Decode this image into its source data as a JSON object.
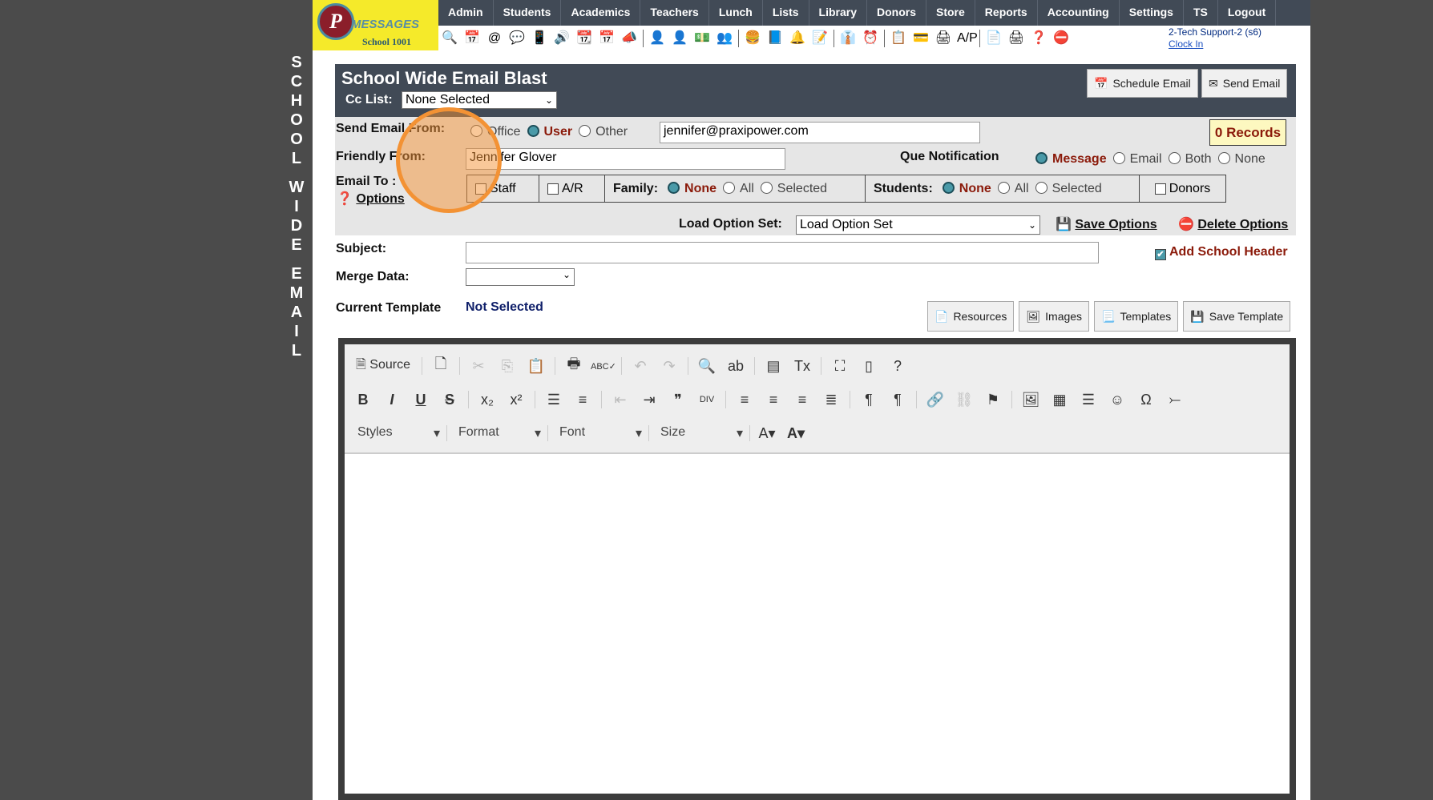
{
  "sidebar_vertical": [
    "S",
    "C",
    "H",
    "O",
    "O",
    "L",
    "",
    "W",
    "I",
    "D",
    "E",
    "",
    "E",
    "M",
    "A",
    "I",
    "L"
  ],
  "logo": {
    "letter": "P",
    "brand": "MESSAGES",
    "school": "School 1001"
  },
  "nav": [
    "Admin",
    "Students",
    "Academics",
    "Teachers",
    "Lunch",
    "Lists",
    "Library",
    "Donors",
    "Store",
    "Reports",
    "Accounting",
    "Settings",
    "TS",
    "Logout"
  ],
  "icon_bar": [
    "🔍",
    "📅",
    "@",
    "💬",
    "📱",
    "🔊",
    "📆",
    "📅",
    "📣",
    "|",
    "👤",
    "👤",
    "💵",
    "👥",
    "|",
    "🍔",
    "📘",
    "🔔",
    "📝",
    "|",
    "👔",
    "⏰",
    "|",
    "📋",
    "💳",
    "🖨",
    "A/P",
    "|",
    "📄",
    "🖨",
    "❓",
    "⛔"
  ],
  "user": {
    "name": "2-Tech Support-2 (s6)",
    "clock_in": "Clock In"
  },
  "header": {
    "title": "School Wide Email Blast",
    "cc_label": "Cc List:",
    "cc_value": "None Selected",
    "schedule": "Schedule Email",
    "send": "Send Email"
  },
  "form": {
    "send_from_label": "Send Email From:",
    "from_options": [
      "Office",
      "User",
      "Other"
    ],
    "from_email": "jennifer@praxipower.com",
    "records": "0 Records",
    "friendly_label": "Friendly From:",
    "friendly_value": "Jennifer Glover",
    "que_label": "Que Notification",
    "que_options": [
      "Message",
      "Email",
      "Both",
      "None"
    ],
    "email_to_label": "Email To :",
    "options_link": "Options",
    "staff": "Staff",
    "ar": "A/R",
    "family_label": "Family:",
    "family_options": [
      "None",
      "All",
      "Selected"
    ],
    "students_label": "Students:",
    "students_options": [
      "None",
      "All",
      "Selected"
    ],
    "donors": "Donors",
    "load_label": "Load Option Set:",
    "load_value": "Load Option Set",
    "save_options": "Save Options",
    "delete_options": "Delete Options",
    "subject_label": "Subject:",
    "subject_value": "",
    "add_header": "Add School Header",
    "merge_label": "Merge Data:",
    "template_label": "Current Template",
    "template_value": "Not Selected",
    "resources": "Resources",
    "images": "Images",
    "templates": "Templates",
    "save_template": "Save Template"
  },
  "editor": {
    "source": "Source",
    "combos": [
      "Styles",
      "Format",
      "Font",
      "Size"
    ]
  }
}
